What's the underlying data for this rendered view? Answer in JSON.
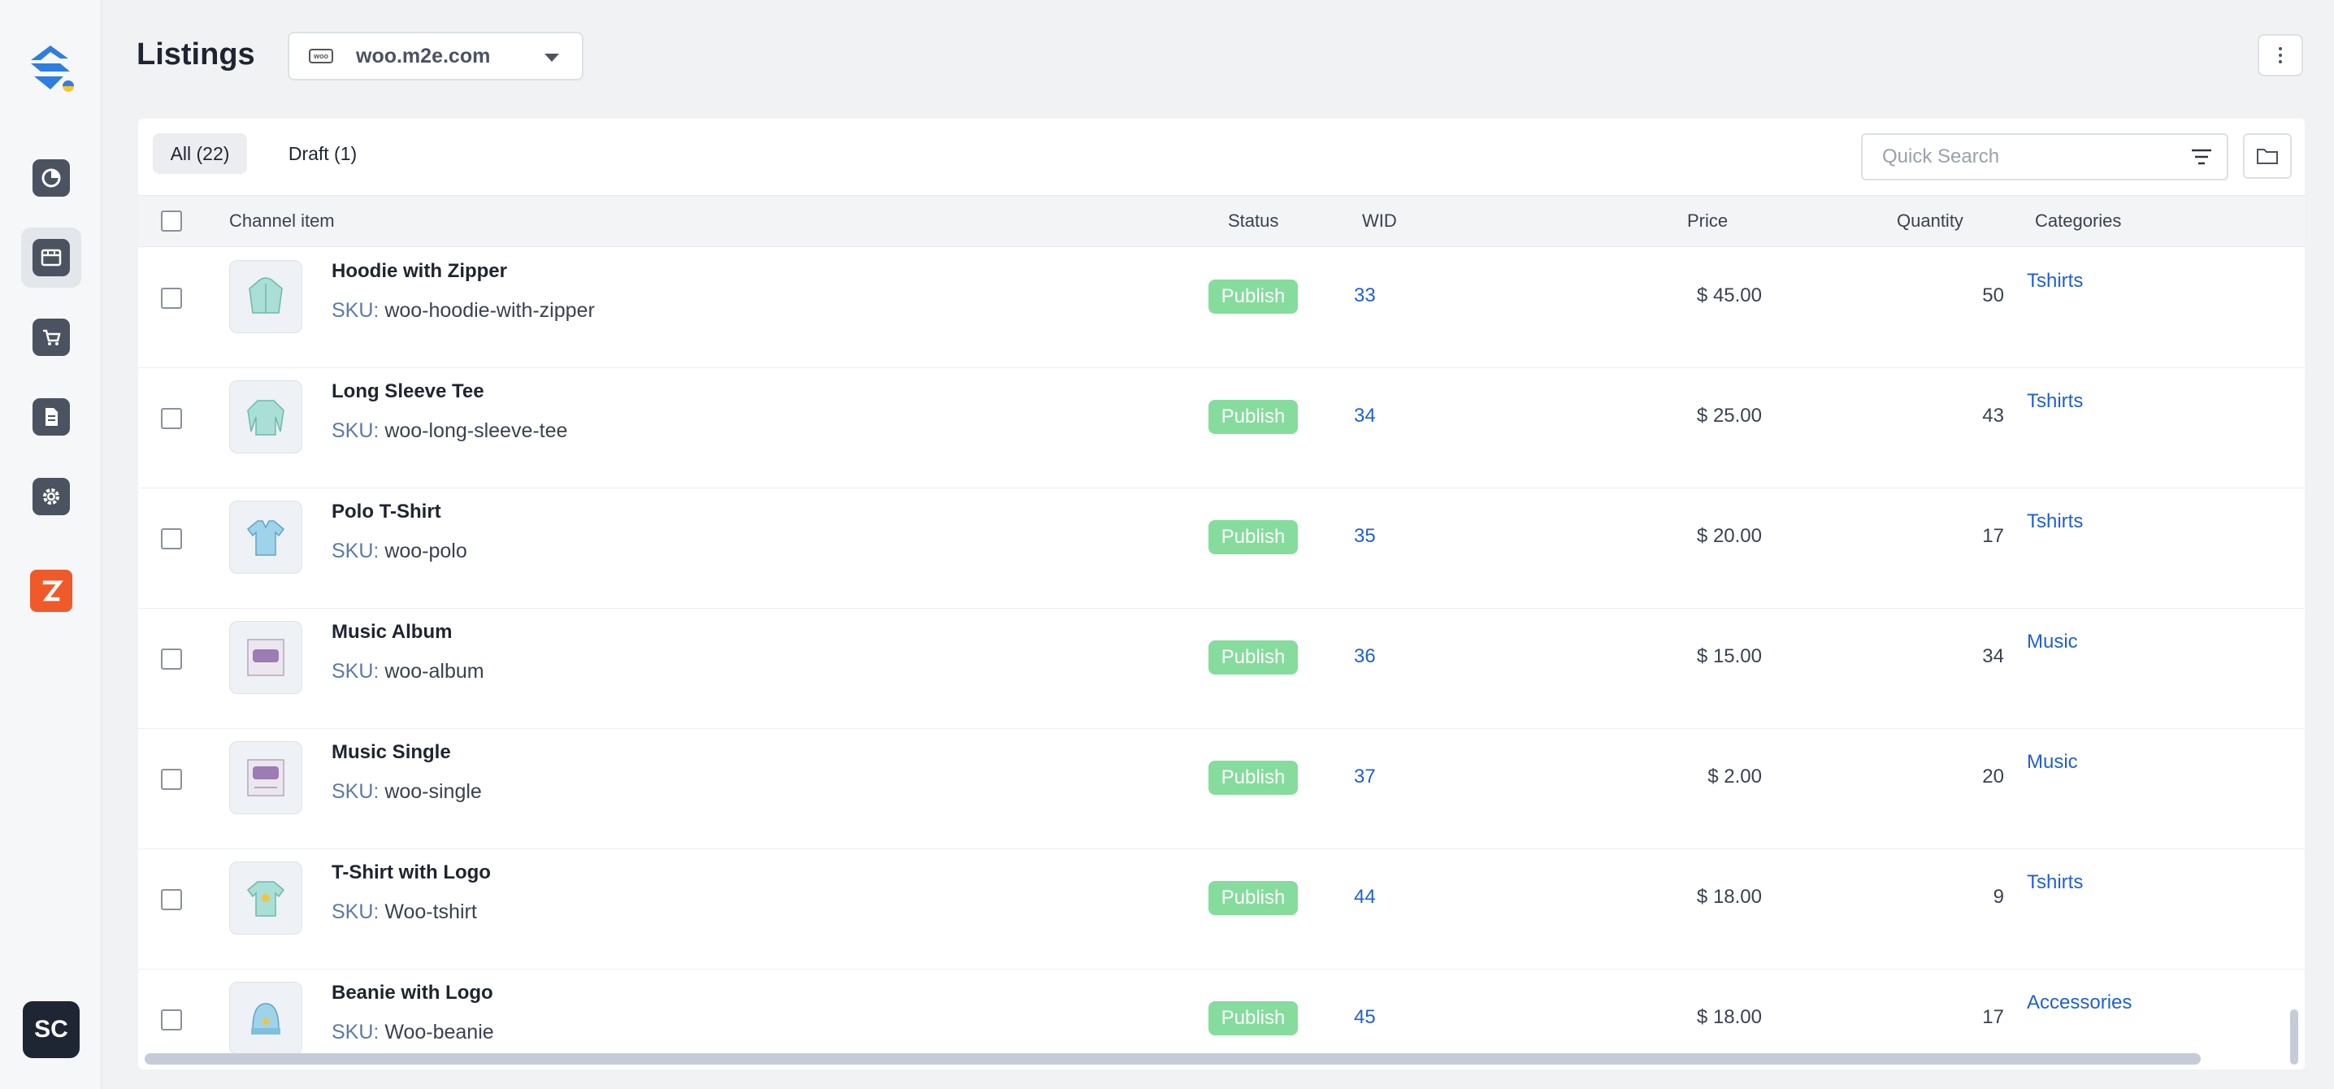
{
  "header": {
    "title": "Listings",
    "store": "woo.m2e.com",
    "store_badge": "woo"
  },
  "user": {
    "initials": "SC"
  },
  "tabs": [
    {
      "label": "All (22)"
    },
    {
      "label": "Draft (1)"
    }
  ],
  "search": {
    "placeholder": "Quick Search"
  },
  "columns": {
    "item": "Channel item",
    "status": "Status",
    "wid": "WID",
    "price": "Price",
    "quantity": "Quantity",
    "categories": "Categories"
  },
  "sku_label": "SKU:",
  "rows": [
    {
      "name": "Hoodie with Zipper",
      "sku": "woo-hoodie-with-zipper",
      "status": "Publish",
      "wid": "33",
      "price": "$ 45.00",
      "quantity": "50",
      "category": "Tshirts",
      "thumb": "hoodie"
    },
    {
      "name": "Long Sleeve Tee",
      "sku": "woo-long-sleeve-tee",
      "status": "Publish",
      "wid": "34",
      "price": "$ 25.00",
      "quantity": "43",
      "category": "Tshirts",
      "thumb": "longsleeve"
    },
    {
      "name": "Polo T-Shirt",
      "sku": "woo-polo",
      "status": "Publish",
      "wid": "35",
      "price": "$ 20.00",
      "quantity": "17",
      "category": "Tshirts",
      "thumb": "polo"
    },
    {
      "name": "Music Album",
      "sku": "woo-album",
      "status": "Publish",
      "wid": "36",
      "price": "$ 15.00",
      "quantity": "34",
      "category": "Music",
      "thumb": "album"
    },
    {
      "name": "Music Single",
      "sku": "woo-single",
      "status": "Publish",
      "wid": "37",
      "price": "$ 2.00",
      "quantity": "20",
      "category": "Music",
      "thumb": "single"
    },
    {
      "name": "T-Shirt with Logo",
      "sku": "Woo-tshirt",
      "status": "Publish",
      "wid": "44",
      "price": "$ 18.00",
      "quantity": "9",
      "category": "Tshirts",
      "thumb": "tshirt"
    },
    {
      "name": "Beanie with Logo",
      "sku": "Woo-beanie",
      "status": "Publish",
      "wid": "45",
      "price": "$ 18.00",
      "quantity": "17",
      "category": "Accessories",
      "thumb": "beanie"
    }
  ],
  "colors": {
    "accent_link": "#1f5fd6",
    "publish_badge": "#86dc9c",
    "sidebar_icon": "#4b5360",
    "brand_orange": "#f05a2a",
    "logo_blue": "#2f7de1"
  }
}
